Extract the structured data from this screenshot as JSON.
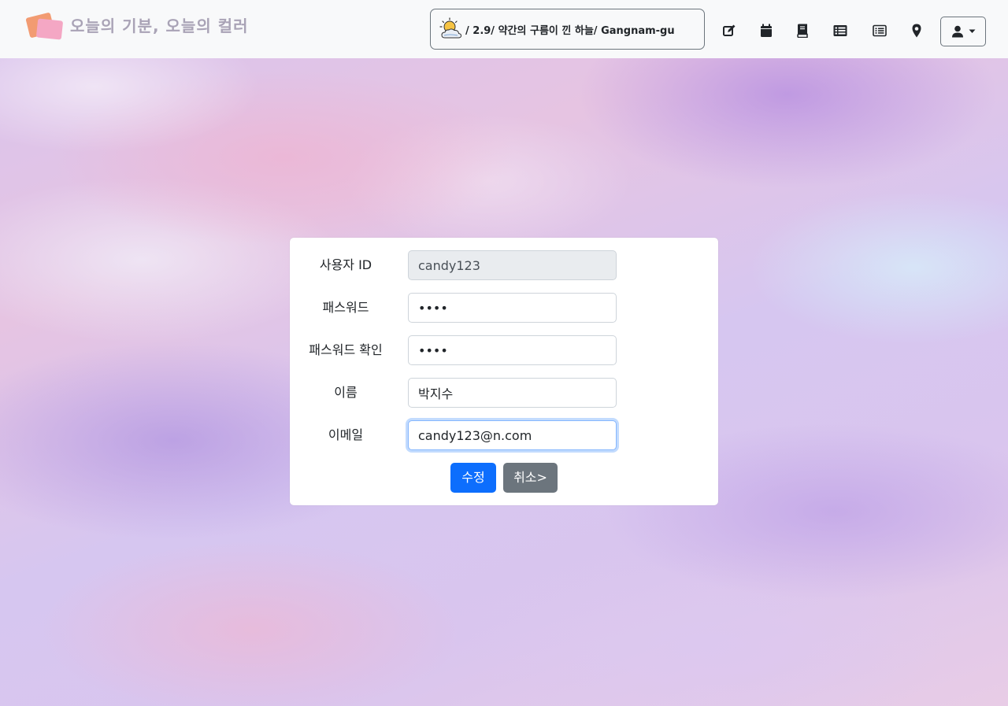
{
  "navbar": {
    "brand_text": "오늘의 기분, 오늘의 컬러",
    "weather": {
      "icon": "partly-cloudy-icon",
      "text": "/ 2.9/ 약간의 구름이 낀 하늘/ Gangnam-gu"
    },
    "icons": [
      "edit-icon",
      "calendar-icon",
      "book-icon",
      "list-icon",
      "list-alt-icon",
      "location-pin-icon",
      "user-icon"
    ]
  },
  "form": {
    "user_id": {
      "label": "사용자 ID",
      "value": "candy123"
    },
    "password": {
      "label": "패스워드",
      "value": "1234"
    },
    "password_confirm": {
      "label": "패스워드 확인",
      "value": "1234"
    },
    "name": {
      "label": "이름",
      "value": "박지수"
    },
    "email": {
      "label": "이메일",
      "value": "candy123@n.com"
    },
    "submit_label": "수정",
    "cancel_label": "취소>"
  },
  "colors": {
    "primary": "#0d6efd",
    "secondary": "#6c757d",
    "navbar_bg": "#f8f9fa"
  }
}
